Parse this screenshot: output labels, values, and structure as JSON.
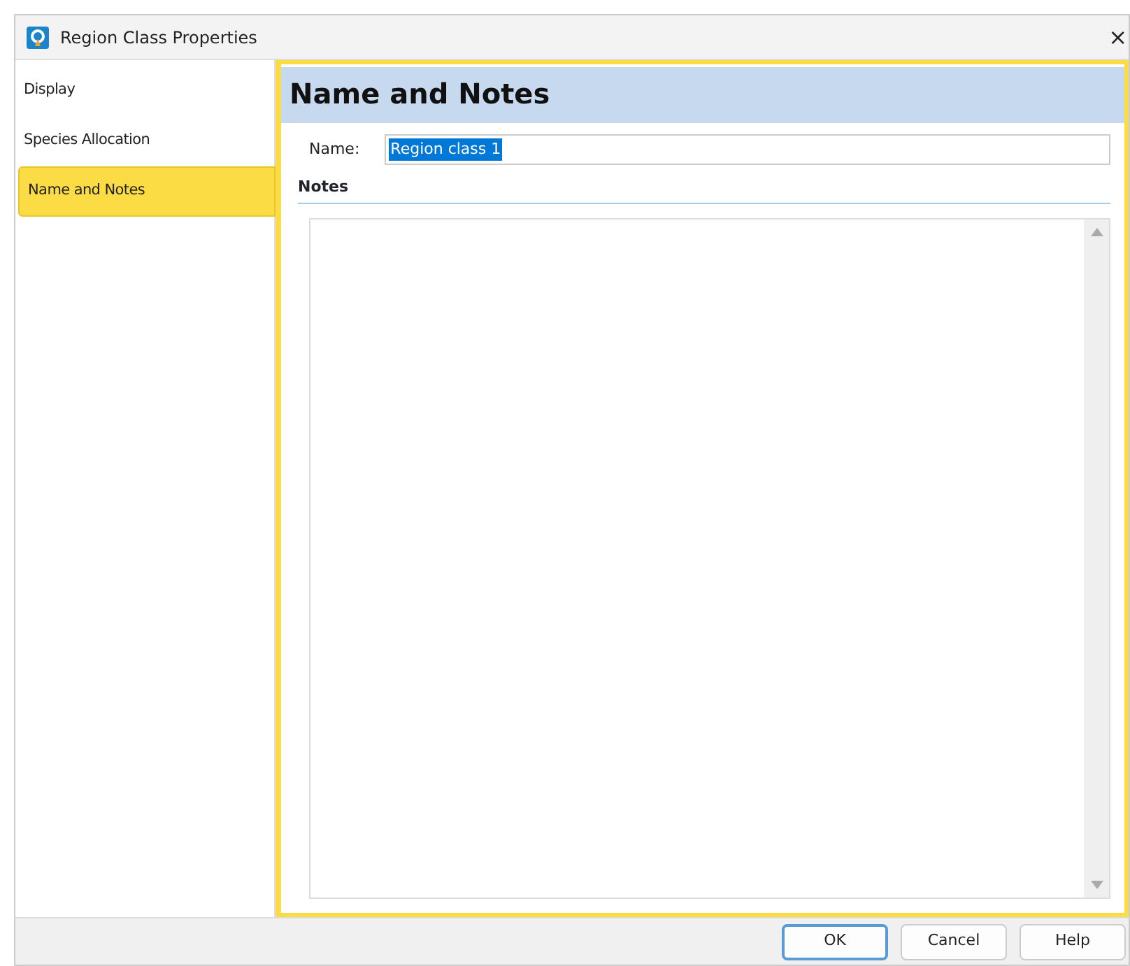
{
  "window": {
    "title": "Region Class Properties",
    "close": "×"
  },
  "sidebar": {
    "items": [
      {
        "label": "Display",
        "selected": false
      },
      {
        "label": "Species Allocation",
        "selected": false
      },
      {
        "label": "Name and Notes",
        "selected": true
      }
    ]
  },
  "panel": {
    "heading": "Name and Notes",
    "name_label": "Name:",
    "name_value": "Region class 1",
    "name_value_selected": true,
    "notes_label": "Notes"
  },
  "buttons": [
    {
      "label": "OK",
      "default": true
    },
    {
      "label": "Cancel",
      "default": false
    },
    {
      "label": "Help",
      "default": false
    }
  ]
}
